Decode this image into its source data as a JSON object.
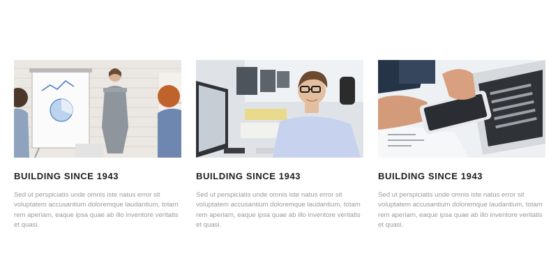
{
  "cards": [
    {
      "photo": "team-presentation-photo",
      "title": "BUILDING SINCE 1943",
      "text": "Sed ut perspiciatis unde omnis iste natus error sit voluptatem accusantium doloremque laudantium, totam rem aperiam, eaque ipsa quae ab illo inventore veritatis et quasi."
    },
    {
      "photo": "office-worker-photo",
      "title": "BUILDING SINCE 1943",
      "text": "Sed ut perspiciatis unde omnis iste natus error sit voluptatem accusantium doloremque laudantium, totam rem aperiam, eaque ipsa quae ab illo inventore veritatis et quasi."
    },
    {
      "photo": "tablet-laptop-photo",
      "title": "BUILDING SINCE 1943",
      "text": "Sed ut perspiciatis unde omnis iste natus error sit voluptatem accusantium doloremque laudantium, totam rem aperiam, eaque ipsa quae ab illo inventore veritatis et quasi."
    }
  ]
}
